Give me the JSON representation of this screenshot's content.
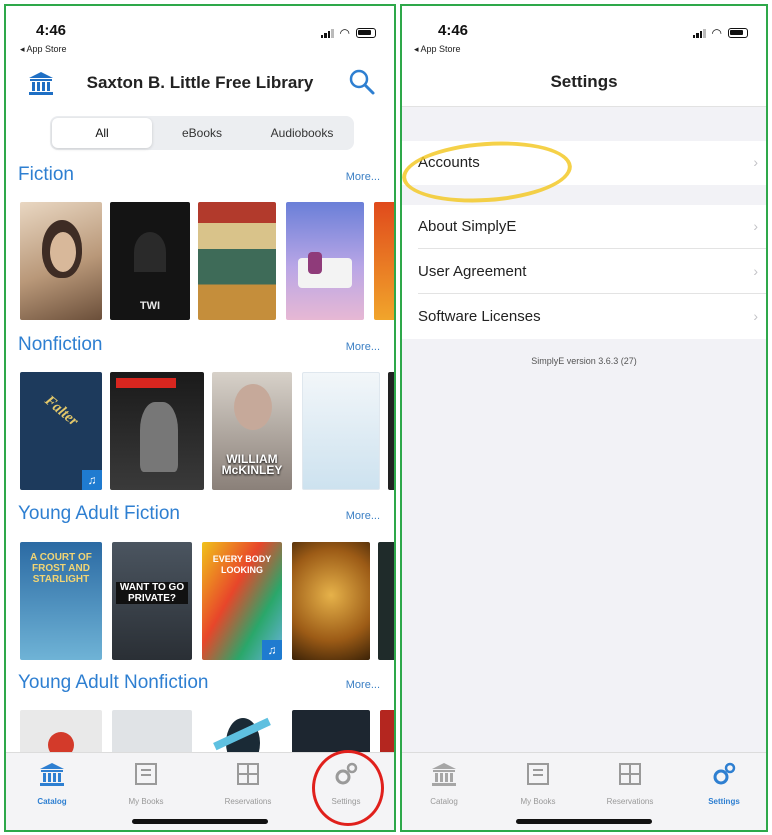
{
  "left_screen": {
    "status": {
      "time": "4:46",
      "back": "◂ App Store"
    },
    "header": {
      "title": "Saxton B. Little Free Library"
    },
    "filter": {
      "all": "All",
      "ebooks": "eBooks",
      "audiobooks": "Audiobooks"
    },
    "lanes": [
      {
        "title": "Fiction",
        "more": "More..."
      },
      {
        "title": "Nonfiction",
        "more": "More..."
      },
      {
        "title": "Young Adult Fiction",
        "more": "More..."
      },
      {
        "title": "Young Adult Nonfiction",
        "more": "More..."
      }
    ],
    "covers": {
      "fiction_2": "TWI",
      "nonfiction_1": "Falter",
      "nonfiction_3": "WILLIAM McKINLEY",
      "ya_1": "A COURT OF FROST AND STARLIGHT",
      "ya_2": "WANT TO GO PRIVATE?",
      "ya_3": "EVERY BODY LOOKING"
    },
    "tabbar": {
      "catalog": "Catalog",
      "mybooks": "My Books",
      "reservations": "Reservations",
      "settings": "Settings"
    }
  },
  "right_screen": {
    "status": {
      "time": "4:46",
      "back": "◂ App Store"
    },
    "title": "Settings",
    "rows": {
      "accounts": "Accounts",
      "about": "About SimplyE",
      "agreement": "User Agreement",
      "licenses": "Software Licenses"
    },
    "chevron": "›",
    "version": "SimplyE version 3.6.3 (27)",
    "tabbar": {
      "catalog": "Catalog",
      "mybooks": "My Books",
      "reservations": "Reservations",
      "settings": "Settings"
    }
  },
  "colors": {
    "accent": "#2e7fd1",
    "frame_border": "#2ea84a",
    "highlight_red": "#e0201c",
    "highlight_yellow": "#f3c928"
  },
  "icons": [
    "library-icon",
    "search-icon",
    "catalog-icon",
    "mybooks-icon",
    "reservations-icon",
    "settings-gear-icon",
    "chevron-right-icon",
    "headphones-icon"
  ]
}
